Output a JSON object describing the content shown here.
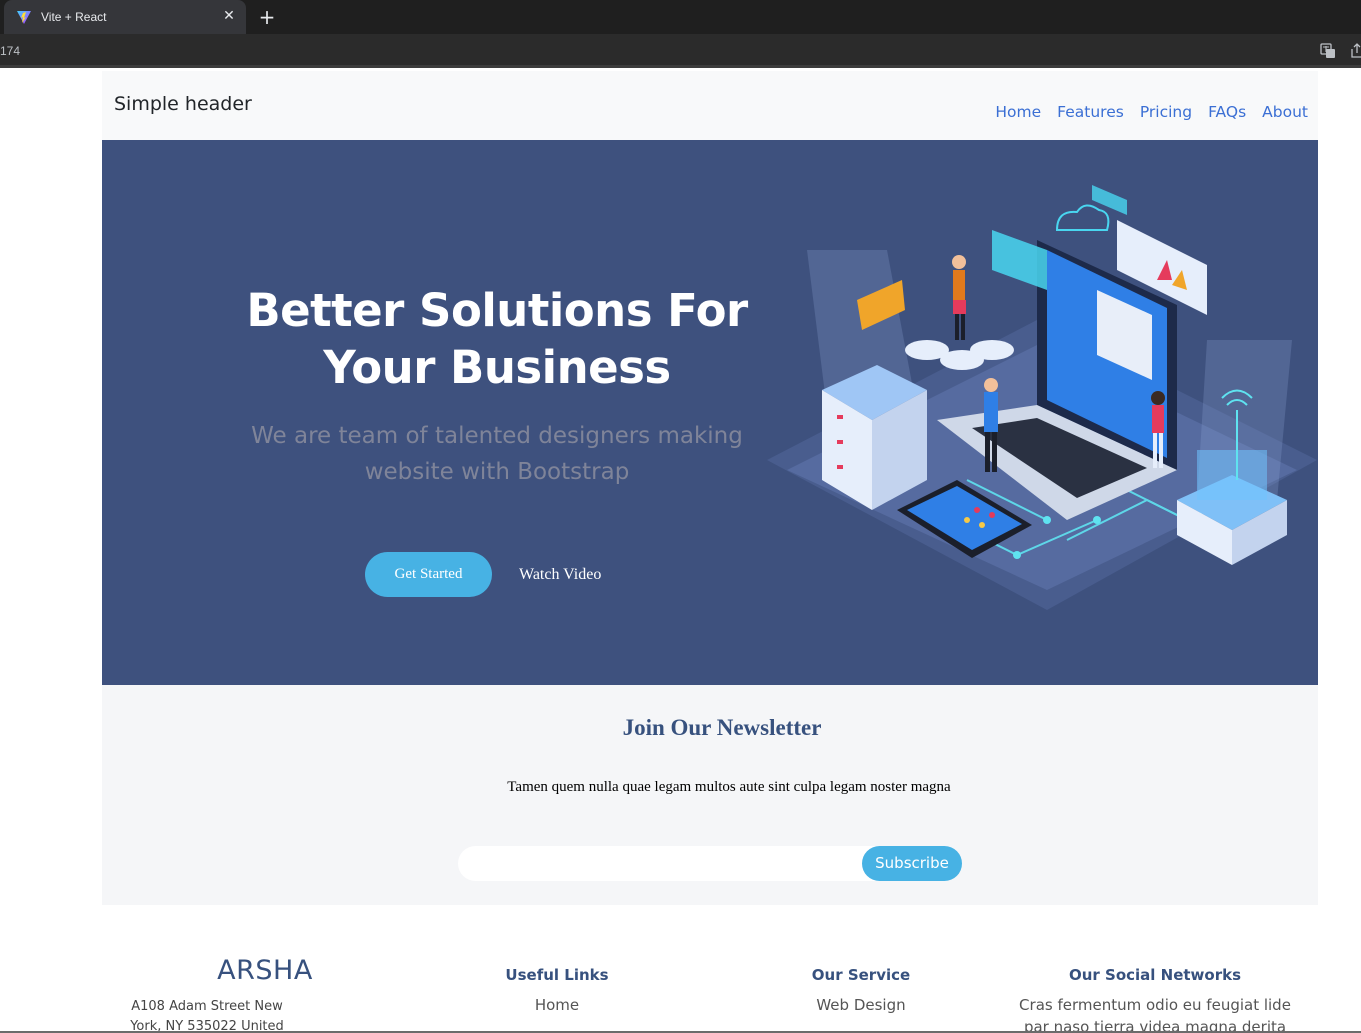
{
  "browser": {
    "tab_title": "Vite + React",
    "close_symbol": "✕",
    "new_tab_symbol": "+",
    "url_text": "174"
  },
  "header": {
    "brand": "Simple header",
    "nav": [
      "Home",
      "Features",
      "Pricing",
      "FAQs",
      "About"
    ]
  },
  "hero": {
    "title": "Better Solutions For Your Business",
    "subtitle": "We are team of talented designers making website with Bootstrap",
    "primary_button": "Get Started",
    "secondary_button": "Watch Video"
  },
  "newsletter": {
    "title": "Join Our Newsletter",
    "text": "Tamen quem nulla quae legam multos aute sint culpa legam noster magna",
    "input_value": "",
    "button": "Subscribe"
  },
  "footer": {
    "brand": "ARSHA",
    "address": "A108 Adam Street New York, NY 535022 United",
    "useful_links": {
      "title": "Useful Links",
      "items": [
        "Home"
      ]
    },
    "our_service": {
      "title": "Our Service",
      "items": [
        "Web Design"
      ]
    },
    "social": {
      "title": "Our Social Networks",
      "text": "Cras fermentum odio eu feugiat lide par naso tierra videa magna derita valies"
    }
  },
  "colors": {
    "hero_bg": "#3e517e",
    "accent": "#47b2e4",
    "nav_link": "#3b6fd4",
    "heading": "#37517e"
  }
}
